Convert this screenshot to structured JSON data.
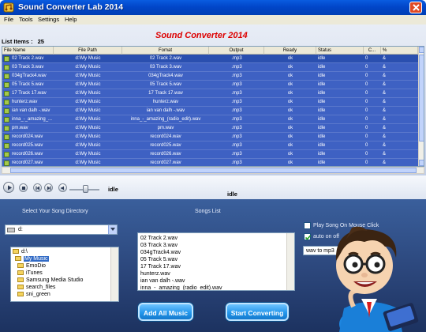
{
  "window": {
    "title": "Sound Converter Lab 2014",
    "brand": "Sound Converter 2014"
  },
  "menu": [
    "File",
    "Tools",
    "Settings",
    "Help"
  ],
  "list": {
    "label": "List Items :",
    "count": "25"
  },
  "table": {
    "columns": [
      "File Name",
      "File Path",
      "Fomat",
      "Output",
      "Ready",
      "Status",
      "C...",
      "%"
    ],
    "rows": [
      {
        "name": "02 Track 2.wav",
        "path": "d:\\My Music",
        "format": "02 Track 2.wav",
        "output": ".mp3",
        "ready": "ok",
        "status": "idle",
        "c": "0",
        "pct": "&"
      },
      {
        "name": "03 Track 3.wav",
        "path": "d:\\My Music",
        "format": "03 Track 3.wav",
        "output": ".mp3",
        "ready": "ok",
        "status": "idle",
        "c": "0",
        "pct": "&"
      },
      {
        "name": "034gTrack4.wav",
        "path": "d:\\My Music",
        "format": "034gTrack4.wav",
        "output": ".mp3",
        "ready": "ok",
        "status": "idle",
        "c": "0",
        "pct": "&"
      },
      {
        "name": "05 Track 5.wav",
        "path": "d:\\My Music",
        "format": "05 Track 5.wav",
        "output": ".mp3",
        "ready": "ok",
        "status": "idle",
        "c": "0",
        "pct": "&"
      },
      {
        "name": "17 Track 17.wav",
        "path": "d:\\My Music",
        "format": "17 Track 17.wav",
        "output": ".mp3",
        "ready": "ok",
        "status": "idle",
        "c": "0",
        "pct": "&"
      },
      {
        "name": "hunterz.wav",
        "path": "d:\\My Music",
        "format": "hunterz.wav",
        "output": ".mp3",
        "ready": "ok",
        "status": "idle",
        "c": "0",
        "pct": "&"
      },
      {
        "name": "ian van dalh -.wav",
        "path": "d:\\My Music",
        "format": "ian van dalh -.wav",
        "output": ".mp3",
        "ready": "ok",
        "status": "idle",
        "c": "0",
        "pct": "&"
      },
      {
        "name": "inna_-_amazing_...",
        "path": "d:\\My Music",
        "format": "inna_-_amazing_(radio_edit).wav",
        "output": ".mp3",
        "ready": "ok",
        "status": "idle",
        "c": "0",
        "pct": "&"
      },
      {
        "name": "pm.wav",
        "path": "d:\\My Music",
        "format": "pm.wav",
        "output": ".mp3",
        "ready": "ok",
        "status": "idle",
        "c": "0",
        "pct": "&"
      },
      {
        "name": "record024.wav",
        "path": "d:\\My Music",
        "format": "record024.wav",
        "output": ".mp3",
        "ready": "ok",
        "status": "idle",
        "c": "0",
        "pct": "&"
      },
      {
        "name": "record025.wav",
        "path": "d:\\My Music",
        "format": "record025.wav",
        "output": ".mp3",
        "ready": "ok",
        "status": "idle",
        "c": "0",
        "pct": "&"
      },
      {
        "name": "record026.wav",
        "path": "d:\\My Music",
        "format": "record026.wav",
        "output": ".mp3",
        "ready": "ok",
        "status": "idle",
        "c": "0",
        "pct": "&"
      },
      {
        "name": "record027.wav",
        "path": "d:\\My Music",
        "format": "record027.wav",
        "output": ".mp3",
        "ready": "ok",
        "status": "idle",
        "c": "0",
        "pct": "&"
      }
    ]
  },
  "player": {
    "status_left": "idle",
    "status_right": "idle"
  },
  "directory": {
    "label": "Select Your Song Directory",
    "drive": "d:",
    "items": [
      "d:\\",
      "My Music",
      "EmoDio",
      "iTunes",
      "Samsung Media Studio",
      "search_files",
      "sni_green"
    ]
  },
  "songs": {
    "label": "Songs List",
    "items": [
      "02 Track 2.wav",
      "03 Track 3.wav",
      "034gTrack4.wav",
      "05 Track 5.wav",
      "17 Track 17.wav",
      "hunterz.wav",
      "ian van dalh -.wav",
      "inna_-_amazing_(radio_edit).wav"
    ]
  },
  "options": {
    "play_on_hover": "Play Song On Mouse Click",
    "play_on_hover_checked": false,
    "auto_on": "auto on off",
    "auto_on_checked": true,
    "format": "wav to mp3"
  },
  "buttons": {
    "add_all": "Add All Music",
    "start": "Start Converting"
  }
}
